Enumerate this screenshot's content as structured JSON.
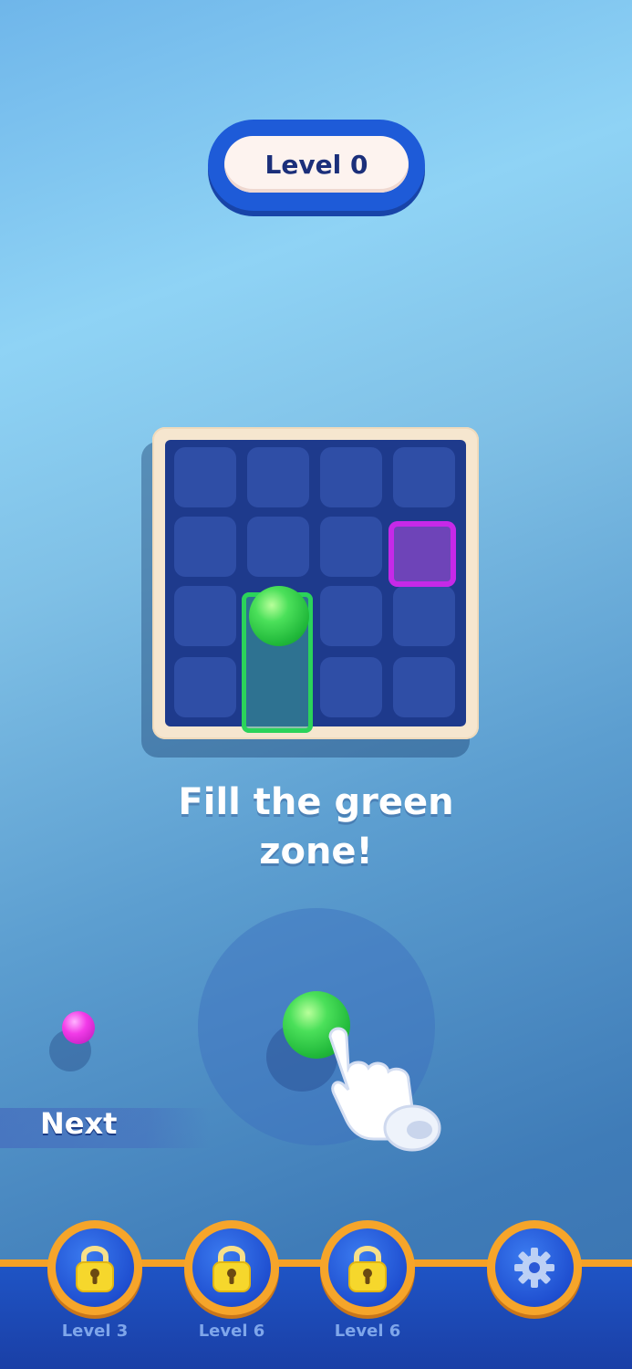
{
  "header": {
    "level_label": "Level 0"
  },
  "instruction": {
    "line1": "Fill the green",
    "line2": "zone!"
  },
  "next": {
    "label": "Next"
  },
  "bottom_nav": {
    "items": [
      {
        "label": "Level 3",
        "icon": "lock-icon",
        "locked": true
      },
      {
        "label": "Level 6",
        "icon": "lock-icon",
        "locked": true
      },
      {
        "label": "Level 6",
        "icon": "lock-icon",
        "locked": true
      },
      {
        "label": "",
        "icon": "gear-icon"
      }
    ]
  },
  "colors": {
    "zone_green": "#2bd35a",
    "target_magenta": "#c629e8",
    "board_frame": "#f6e6cf",
    "board_bg": "#1e3a8c",
    "nav_ring": "#f6a52a"
  }
}
